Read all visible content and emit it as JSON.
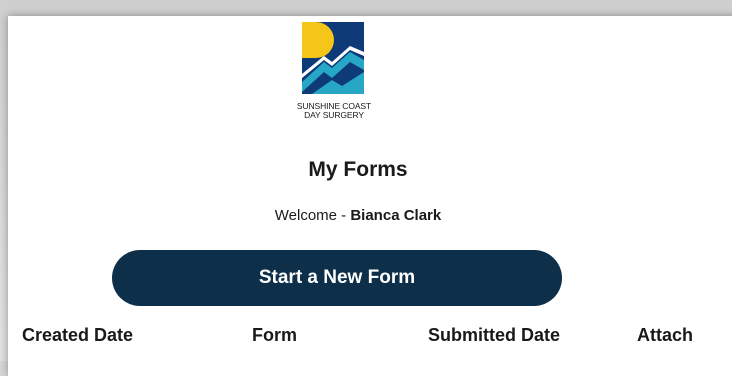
{
  "logo": {
    "name": "sunshine-coast-day-surgery-logo",
    "line1": "SUNSHINE COAST",
    "line2": "DAY SURGERY",
    "colors": {
      "navy": "#0e3a78",
      "sun": "#f5c518",
      "teal": "#27a7c6"
    }
  },
  "page": {
    "title": "My Forms",
    "welcome_prefix": "Welcome - ",
    "user_name": "Bianca Clark"
  },
  "actions": {
    "start_new_form": "Start a New Form"
  },
  "table": {
    "headers": [
      "Created Date",
      "Form",
      "Submitted Date",
      "Attach"
    ]
  },
  "colors": {
    "button": "#0e2f4a",
    "text": "#1a1a1a"
  }
}
